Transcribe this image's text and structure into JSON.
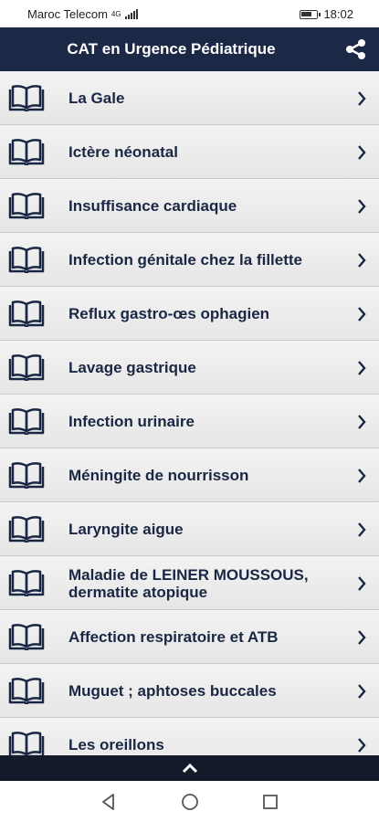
{
  "status_bar": {
    "carrier": "Maroc Telecom",
    "network": "4G",
    "time": "18:02"
  },
  "app_bar": {
    "title": "CAT en Urgence Pédiatrique",
    "share_icon": "share-icon"
  },
  "list": {
    "items": [
      {
        "label": "La Gale"
      },
      {
        "label": "Ictère néonatal"
      },
      {
        "label": "Insuffisance cardiaque"
      },
      {
        "label": "Infection génitale chez la fillette"
      },
      {
        "label": "Reflux gastro-œs ophagien"
      },
      {
        "label": "Lavage gastrique"
      },
      {
        "label": "Infection urinaire"
      },
      {
        "label": "Méningite de nourrisson"
      },
      {
        "label": "Laryngite aigue"
      },
      {
        "label": "Maladie de LEINER MOUSSOUS, dermatite atopique"
      },
      {
        "label": "Affection respiratoire et ATB"
      },
      {
        "label": "Muguet ; aphtoses buccales"
      },
      {
        "label": "Les oreillons"
      }
    ]
  },
  "colors": {
    "app_bar": "#1b2846",
    "label": "#1a2744",
    "bottom_bar": "#131a29"
  }
}
